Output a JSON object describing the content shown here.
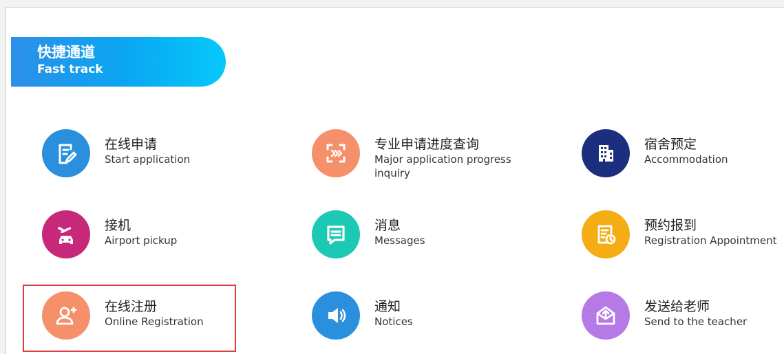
{
  "header": {
    "title_zh": "快捷通道",
    "title_en": "Fast track"
  },
  "items": [
    {
      "zh": "在线申请",
      "en": "Start application",
      "color": "#2a8fdc",
      "icon": "document-edit-icon"
    },
    {
      "zh": "专业申请进度查询",
      "en": "Major application progress inquiry",
      "color": "#f6906a",
      "icon": "progress-scan-icon"
    },
    {
      "zh": "宿舍预定",
      "en": "Accommodation",
      "color": "#1c2f7e",
      "icon": "building-icon"
    },
    {
      "zh": "接机",
      "en": "Airport pickup",
      "color": "#c8287a",
      "icon": "airplane-car-icon"
    },
    {
      "zh": "消息",
      "en": "Messages",
      "color": "#1bc9b5",
      "icon": "message-icon"
    },
    {
      "zh": "预约报到",
      "en": "Registration Appointment",
      "color": "#f5ad16",
      "icon": "calendar-clock-icon"
    },
    {
      "zh": "在线注册",
      "en": "Online Registration",
      "color": "#f6906a",
      "icon": "user-add-icon"
    },
    {
      "zh": "通知",
      "en": "Notices",
      "color": "#2a8fdc",
      "icon": "speaker-icon"
    },
    {
      "zh": "发送给老师",
      "en": "Send to the teacher",
      "color": "#b57ae6",
      "icon": "envelope-send-icon"
    }
  ]
}
